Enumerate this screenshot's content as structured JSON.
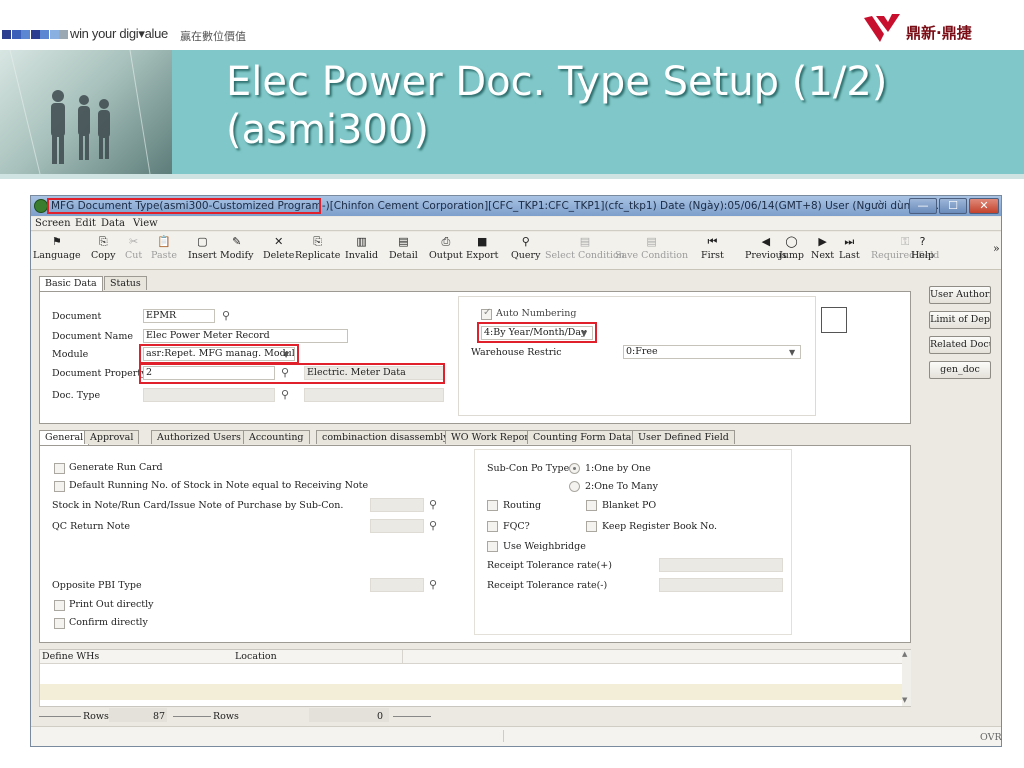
{
  "slide": {
    "slogan": "win your digi▾alue",
    "slogan_cn": "贏在數位價值",
    "logo_text": "鼎新·鼎捷",
    "title_line1": "Elec Power Doc. Type Setup (1/2)",
    "title_line2": "(asmi300)",
    "square_colors": [
      "#2b3e8f",
      "#3a5fb8",
      "#5b86d1",
      "#2b3e8f",
      "#5b86d1",
      "#8ab0e2",
      "#9aa8b4"
    ],
    "accent": "#7fc7c8",
    "logo_color": "#c8102e"
  },
  "window": {
    "title": "MFG Document Type(asmi300-Customized Program-)[Chinfon Cement Corporation][CFC_TKP1:CFC_TKP1](cfc_tkp1) Date (Ngày):05/06/14(GMT+8) User (Người dùng):Di...",
    "btn_min": "—",
    "btn_max": "☐",
    "btn_close": "✕"
  },
  "menu": [
    "Screen",
    "Edit",
    "Data",
    "View"
  ],
  "toolbar": [
    {
      "label": "Language",
      "icon": "⚑",
      "icon_name": "flag-icon",
      "enabled": true
    },
    {
      "label": "Copy",
      "icon": "⎘",
      "icon_name": "copy-icon",
      "enabled": true
    },
    {
      "label": "Cut",
      "icon": "✂",
      "icon_name": "cut-icon",
      "enabled": false
    },
    {
      "label": "Paste",
      "icon": "📋",
      "icon_name": "paste-icon",
      "enabled": false
    },
    {
      "label": "Insert",
      "icon": "▢",
      "icon_name": "insert-icon",
      "enabled": true
    },
    {
      "label": "Modify",
      "icon": "✎",
      "icon_name": "modify-icon",
      "enabled": true
    },
    {
      "label": "Delete",
      "icon": "✕",
      "icon_name": "delete-icon",
      "enabled": true
    },
    {
      "label": "Replicate",
      "icon": "⎘",
      "icon_name": "replicate-icon",
      "enabled": true
    },
    {
      "label": "Invalid",
      "icon": "▥",
      "icon_name": "invalid-icon",
      "enabled": true
    },
    {
      "label": "Detail",
      "icon": "▤",
      "icon_name": "detail-icon",
      "enabled": true
    },
    {
      "label": "Output",
      "icon": "⎙",
      "icon_name": "output-icon",
      "enabled": true
    },
    {
      "label": "Export",
      "icon": "■",
      "icon_name": "export-icon",
      "enabled": true
    },
    {
      "label": "Query",
      "icon": "⚲",
      "icon_name": "query-icon",
      "enabled": true
    },
    {
      "label": "Select Condition",
      "icon": "▤",
      "icon_name": "select-condition-icon",
      "enabled": false
    },
    {
      "label": "Save Condition",
      "icon": "▤",
      "icon_name": "save-condition-icon",
      "enabled": false
    },
    {
      "label": "First",
      "icon": "⏮",
      "icon_name": "first-icon",
      "enabled": true
    },
    {
      "label": "Previous",
      "icon": "◀",
      "icon_name": "previous-icon",
      "enabled": true
    },
    {
      "label": "Jump",
      "icon": "◯",
      "icon_name": "jump-icon",
      "enabled": true
    },
    {
      "label": "Next",
      "icon": "▶",
      "icon_name": "next-icon",
      "enabled": true
    },
    {
      "label": "Last",
      "icon": "⏭",
      "icon_name": "last-icon",
      "enabled": true
    },
    {
      "label": "Required field",
      "icon": "⚿",
      "icon_name": "key-icon",
      "enabled": false
    },
    {
      "label": "Help",
      "icon": "?",
      "icon_name": "help-icon",
      "enabled": true
    }
  ],
  "toolbar_more": "»",
  "top_tabs": [
    "Basic Data",
    "Status"
  ],
  "basic": {
    "document_label": "Document",
    "document_value": "EPMR",
    "document_name_label": "Document Name",
    "document_name_value": "Elec Power Meter Record",
    "module_label": "Module",
    "module_value": "asr:Repet. MFG manag. Module",
    "property_label": "Document Property",
    "property_value": "2",
    "property_desc": "Electric. Meter Data",
    "doctype_label": "Doc. Type",
    "auto_numbering_label": "Auto Numbering",
    "auto_numbering_checked": true,
    "numbering_value": "4:By Year/Month/Day",
    "warehouse_label": "Warehouse Restric",
    "warehouse_value": "0:Free"
  },
  "side_buttons": [
    "User Authori",
    "Limit of Dep",
    "Related Docu",
    "gen_doc"
  ],
  "bottom_tabs": [
    "General",
    "Approval",
    "Authorized Users",
    "Accounting",
    "combinaction disassembly",
    "WO Work Report",
    "Counting Form Data",
    "User Defined Field"
  ],
  "general": {
    "generate_run_card": "Generate Run Card",
    "default_running_no": "Default Running No. of Stock in Note equal to Receiving Note",
    "stock_in_note": "Stock in Note/Run Card/Issue Note of Purchase by Sub-Con.",
    "qc_return_note": "QC Return Note",
    "opposite_pbi": "Opposite PBI Type",
    "print_out": "Print Out directly",
    "confirm": "Confirm directly",
    "subcon_label": "Sub-Con Po Type",
    "subcon_opt1": "1:One by One",
    "subcon_opt2": "2:One To Many",
    "routing": "Routing",
    "blanket_po": "Blanket PO",
    "fqc": "FQC?",
    "keep_register": "Keep Register Book No.",
    "use_weighbridge": "Use Weighbridge",
    "tol_plus": "Receipt Tolerance rate(+)",
    "tol_minus": "Receipt Tolerance rate(-)"
  },
  "grid": {
    "col1": "Define WHs",
    "col2": "Location"
  },
  "status": {
    "rows_label1": "Rows",
    "rows_value1": "87",
    "rows_label2": "Rows",
    "rows_value2": "0",
    "ovr": "OVR"
  }
}
